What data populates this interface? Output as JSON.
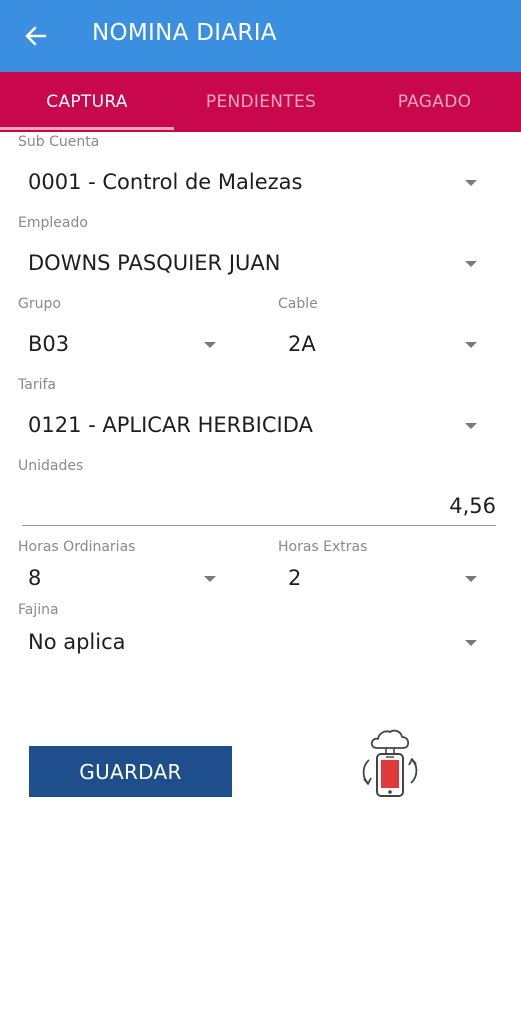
{
  "appbar": {
    "title": "NOMINA DIARIA",
    "back_icon": "arrow-back-icon"
  },
  "tabs": [
    {
      "label": "CAPTURA",
      "active": true
    },
    {
      "label": "PENDIENTES",
      "active": false
    },
    {
      "label": "PAGADO",
      "active": false
    }
  ],
  "colors": {
    "appbar": "#3a8fe0",
    "tabs": "#c8084a",
    "save_button": "#1f4e8c",
    "accent_red": "#e03a3a"
  },
  "form": {
    "sub_cuenta": {
      "label": "Sub Cuenta",
      "value": "0001 - Control de Malezas"
    },
    "empleado": {
      "label": "Empleado",
      "value": "DOWNS PASQUIER JUAN"
    },
    "grupo": {
      "label": "Grupo",
      "value": "B03"
    },
    "cable": {
      "label": "Cable",
      "value": "2A"
    },
    "tarifa": {
      "label": "Tarifa",
      "value": "0121 - APLICAR HERBICIDA"
    },
    "unidades": {
      "label": "Unidades",
      "value": "4,56"
    },
    "horas_ordinarias": {
      "label": "Horas Ordinarias",
      "value": "8"
    },
    "horas_extras": {
      "label": "Horas Extras",
      "value": "2"
    },
    "fajina": {
      "label": "Fajina",
      "value": "No aplica"
    }
  },
  "actions": {
    "save_label": "GUARDAR",
    "sync_icon": "cloud-phone-sync-icon"
  }
}
